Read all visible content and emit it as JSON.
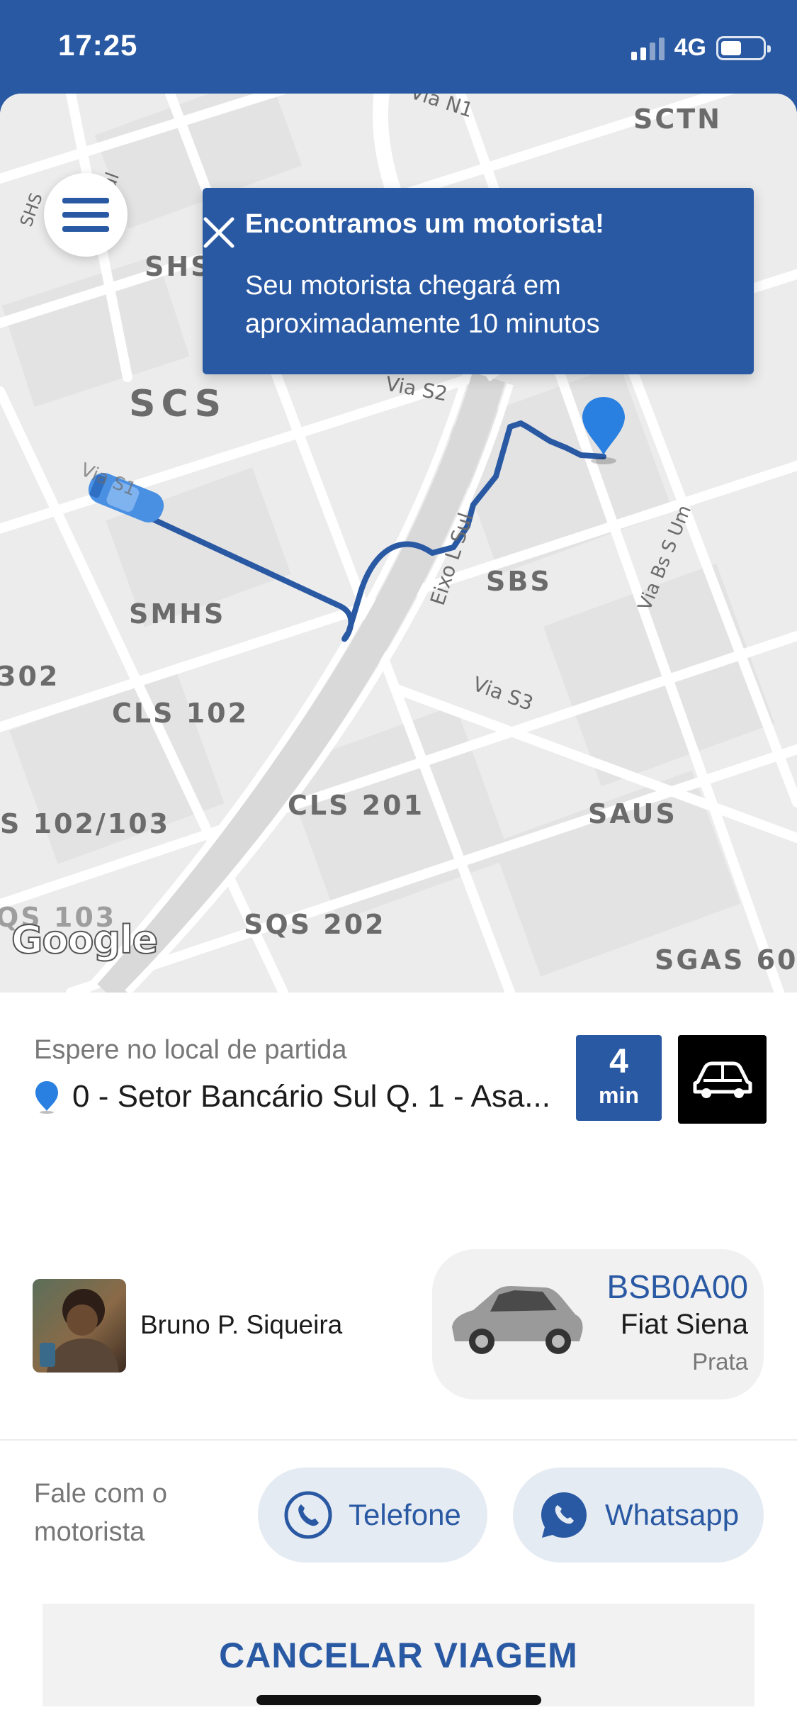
{
  "status_bar": {
    "time": "17:25",
    "network": "4G"
  },
  "map": {
    "labels": [
      "SCTN",
      "SHS",
      "SCS",
      "SBS",
      "SMHS",
      "CLS 102",
      "302",
      "S 102/103",
      "CLS 201",
      "SAUS",
      "SQS 202",
      "SGAS 60",
      "QS 103"
    ],
    "streets": [
      "Via N1",
      "Via S2",
      "Eixo L Sul",
      "Via Bs S Um",
      "Via S3",
      "Via S1",
      "SHS",
      "W3 Sul"
    ],
    "attribution": "Google",
    "route_color": "#2a59a3"
  },
  "notification": {
    "title": "Encontramos um motorista!",
    "message": "Seu motorista chegará em aproximadamente 10 minutos"
  },
  "trip": {
    "wait_label": "Espere no local de partida",
    "address": "0 - Setor Bancário Sul Q. 1 - Asa...",
    "eta_value": "4",
    "eta_unit": "min"
  },
  "driver": {
    "name": "Bruno P. Siqueira"
  },
  "vehicle": {
    "plate": "BSB0A00",
    "model": "Fiat Siena",
    "color": "Prata"
  },
  "contact": {
    "label": "Fale com o motorista",
    "phone_label": "Telefone",
    "whatsapp_label": "Whatsapp"
  },
  "actions": {
    "cancel_label": "CANCELAR VIAGEM"
  },
  "colors": {
    "brand": "#2a59a3",
    "background": "#ffffff"
  }
}
